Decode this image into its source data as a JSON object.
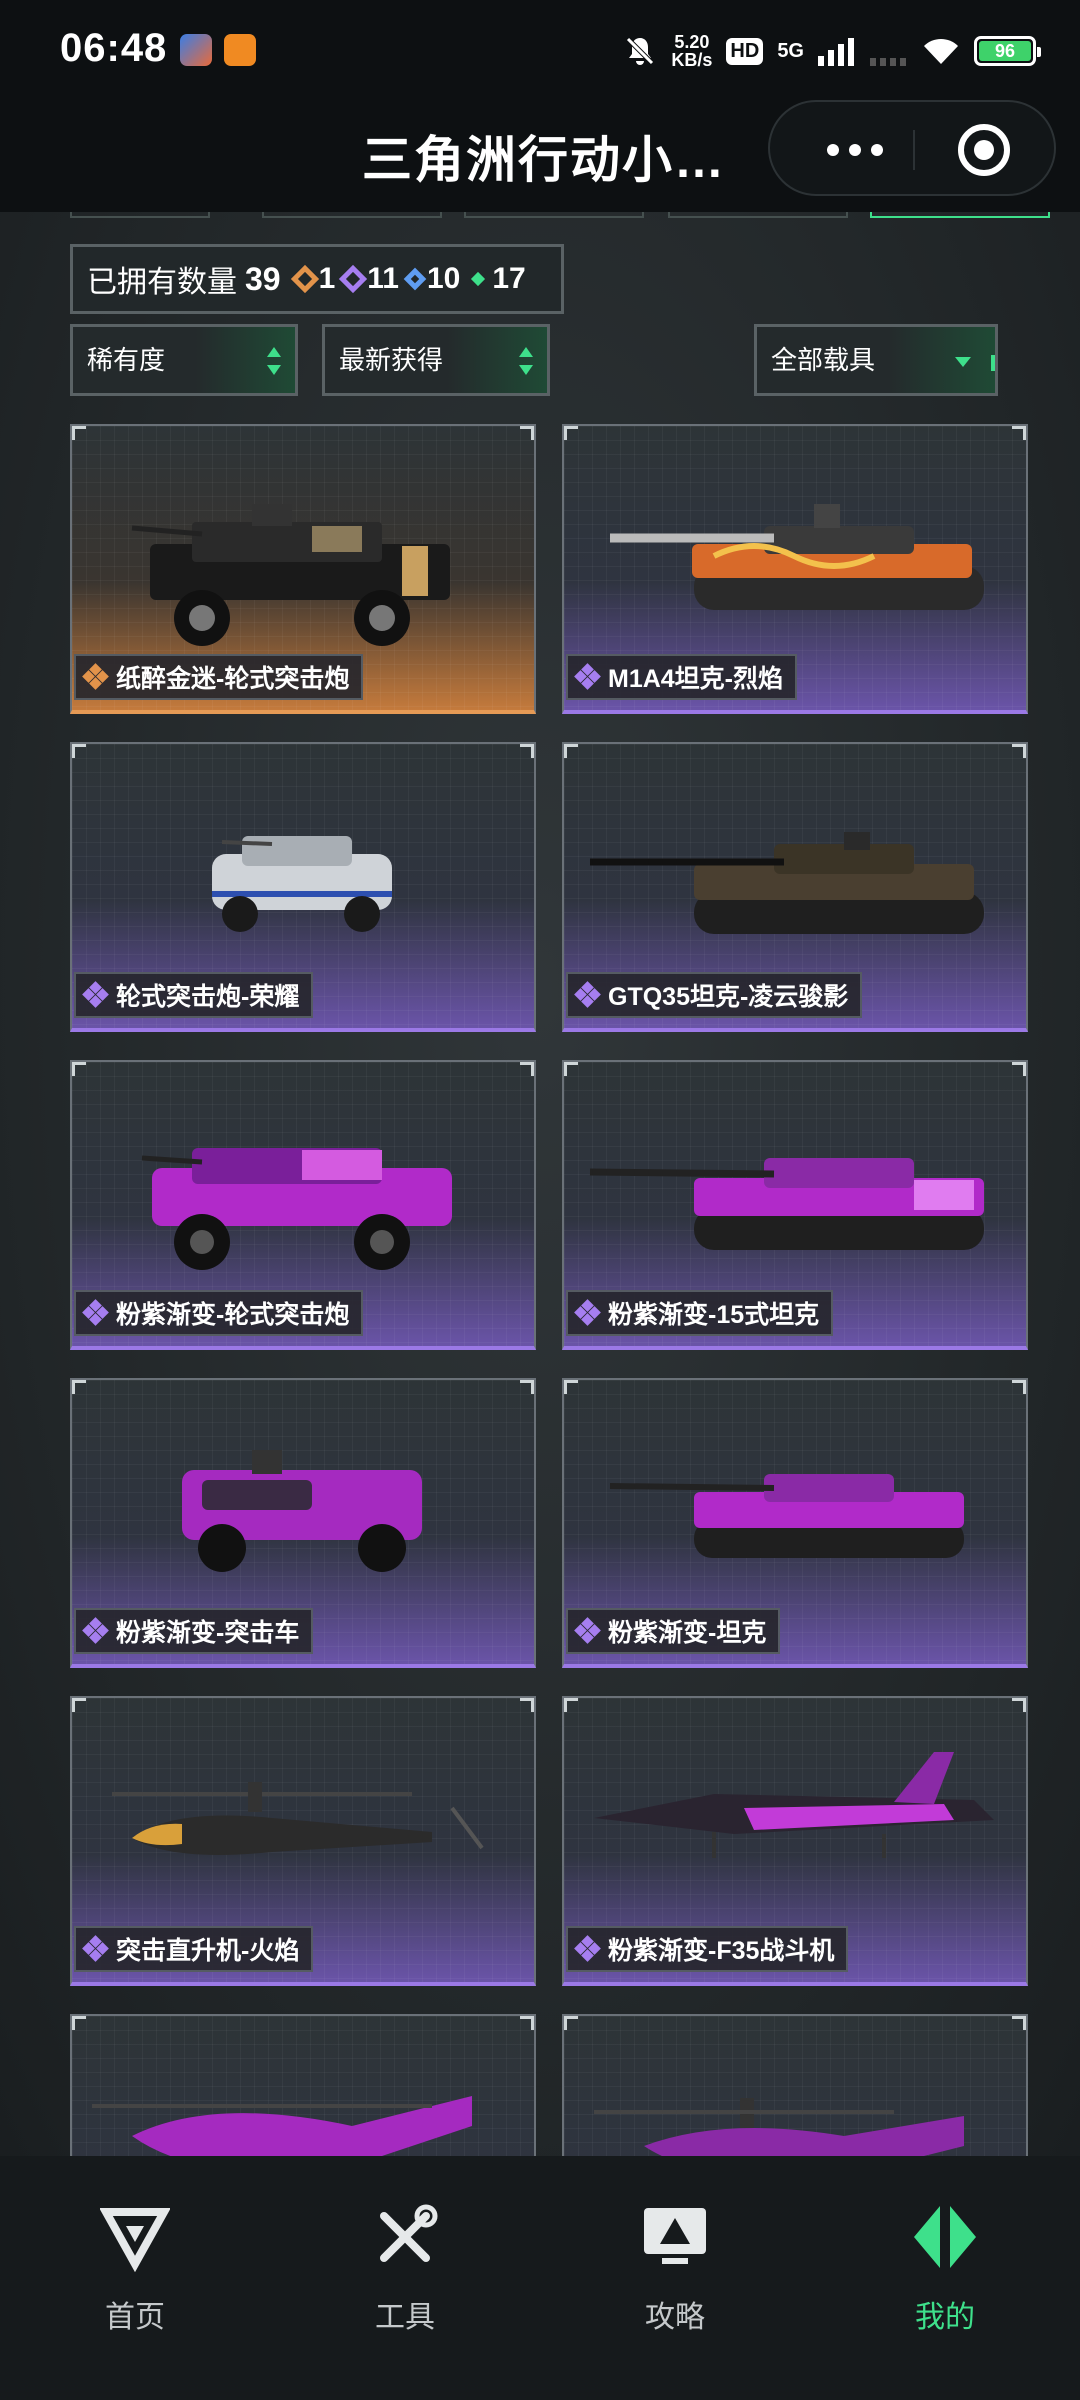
{
  "status_bar": {
    "time": "06:48",
    "net_speed_value": "5.20",
    "net_speed_unit": "KB/s",
    "hd_label": "HD",
    "network_label": "5G",
    "battery": "96"
  },
  "header": {
    "title": "三角洲行动小…"
  },
  "collection": {
    "owned_label": "已拥有数量",
    "owned_total": "39",
    "rarity_counts": [
      {
        "count": "1",
        "color": "#e2934a"
      },
      {
        "count": "11",
        "color": "#a67ef0"
      },
      {
        "count": "10",
        "color": "#5f9df2"
      },
      {
        "count": "17",
        "color": "#3ee08b"
      }
    ]
  },
  "filters": {
    "rarity": "稀有度",
    "sort": "最新获得",
    "vehicle_type": "全部载具"
  },
  "items": [
    {
      "name": "纸醉金迷-轮式突击炮",
      "rarity_color": "#e2934a"
    },
    {
      "name": "M1A4坦克-烈焰",
      "rarity_color": "#a67ef0"
    },
    {
      "name": "轮式突击炮-荣耀",
      "rarity_color": "#a67ef0"
    },
    {
      "name": "GTQ35坦克-凌云骏影",
      "rarity_color": "#a67ef0"
    },
    {
      "name": "粉紫渐变-轮式突击炮",
      "rarity_color": "#a67ef0"
    },
    {
      "name": "粉紫渐变-15式坦克",
      "rarity_color": "#a67ef0"
    },
    {
      "name": "粉紫渐变-突击车",
      "rarity_color": "#a67ef0"
    },
    {
      "name": "粉紫渐变-坦克",
      "rarity_color": "#a67ef0"
    },
    {
      "name": "突击直升机-火焰",
      "rarity_color": "#a67ef0"
    },
    {
      "name": "粉紫渐变-F35战斗机",
      "rarity_color": "#a67ef0"
    },
    {
      "name": "",
      "rarity_color": "#a67ef0"
    },
    {
      "name": "",
      "rarity_color": "#a67ef0"
    }
  ],
  "tabbar": {
    "tabs": [
      {
        "label": "首页",
        "icon": "logo-icon"
      },
      {
        "label": "工具",
        "icon": "tools-icon"
      },
      {
        "label": "攻略",
        "icon": "guide-icon"
      },
      {
        "label": "我的",
        "icon": "profile-icon"
      }
    ],
    "active_color": "#3ee08b"
  }
}
